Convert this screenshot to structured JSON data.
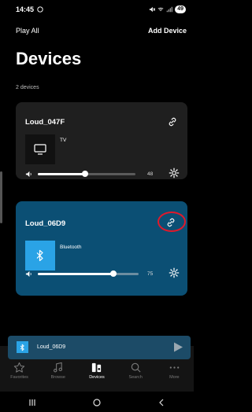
{
  "status": {
    "time": "14:45",
    "battery": "49"
  },
  "header": {
    "play_all_label": "Play All",
    "add_device_label": "Add Device",
    "title": "Devices",
    "device_count": "2 devices"
  },
  "devices": [
    {
      "name": "Loud_047F",
      "source_label": "TV",
      "source_icon": "tv-icon",
      "volume": 48,
      "volume_text": "48"
    },
    {
      "name": "Loud_06D9",
      "source_label": "Bluetooth",
      "source_icon": "bluetooth-icon",
      "volume": 75,
      "volume_text": "75",
      "highlighted_control": "link-icon",
      "highlight_color": "#e0192b"
    }
  ],
  "mini_player": {
    "device_name": "Loud_06D9",
    "icon": "bluetooth-icon"
  },
  "nav": {
    "items": [
      {
        "label": "Favorites",
        "icon": "star-icon"
      },
      {
        "label": "Browse",
        "icon": "music-note-icon"
      },
      {
        "label": "Devices",
        "icon": "devices-icon",
        "active": true
      },
      {
        "label": "Search",
        "icon": "search-icon"
      },
      {
        "label": "More",
        "icon": "more-icon"
      }
    ]
  },
  "colors": {
    "active_card": "#0b4f74",
    "inactive_card": "#1f1f1f",
    "bluetooth_accent": "#2aa3e6",
    "highlight": "#e0192b"
  }
}
